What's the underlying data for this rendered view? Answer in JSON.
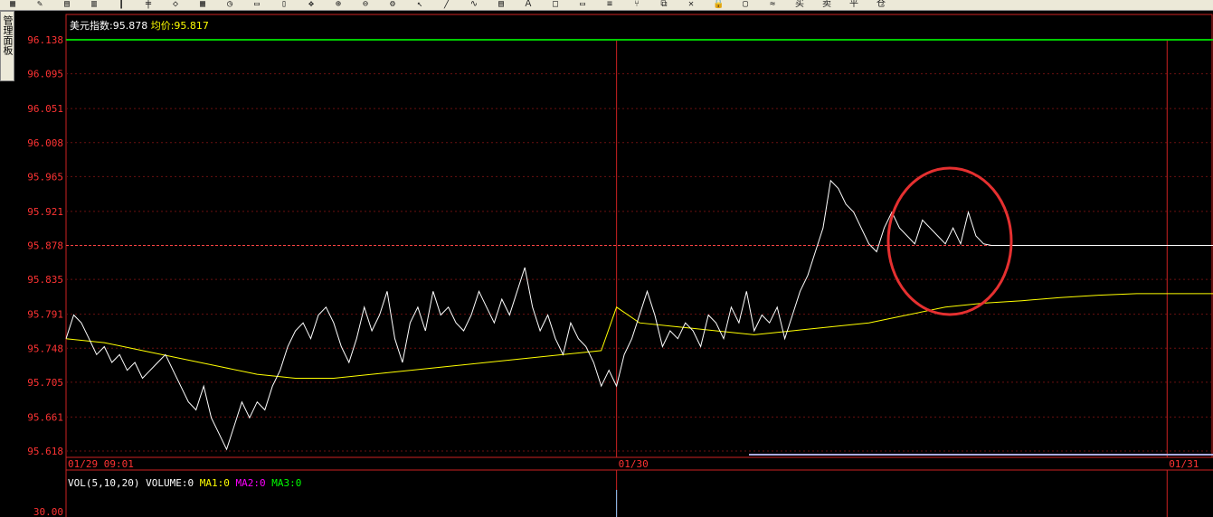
{
  "toolbar": {
    "icons": [
      "grid-icon",
      "pencil-icon",
      "chart-icon",
      "bar-icon",
      "bars-icon",
      "candle-icon",
      "diamond-icon",
      "grid2-icon",
      "clock-icon",
      "doc-icon",
      "doc2-icon",
      "move-icon",
      "zoom-in-icon",
      "zoom-out-icon",
      "gear-icon",
      "arrow-cursor-icon",
      "line-tool-icon",
      "curve-icon",
      "table-icon",
      "text-icon",
      "box-icon",
      "box2-icon",
      "channel-icon",
      "fork-icon",
      "copy-icon",
      "delete-icon",
      "lock-icon",
      "page-icon",
      "mark-icon",
      "buy-icon",
      "sell-icon",
      "flat-icon",
      "down-icon"
    ]
  },
  "side_tab": {
    "label": "管理面板"
  },
  "info": {
    "symbol_label": "美元指数:95.878",
    "avg_label": "均价:95.817"
  },
  "volume_panel": {
    "label": "VOL(5,10,20) VOLUME:0",
    "ma1": "MA1:0",
    "ma2": "MA2:0",
    "ma3": "MA3:0",
    "axis_label": "30.00"
  },
  "colors": {
    "price": "#ffffff",
    "average": "#ffff00",
    "axis_text": "#ff3333",
    "frame": "#cc2222",
    "current_line": "#ff4444",
    "high_line": "#00cc00",
    "circle": "#e53030"
  },
  "chart_data": {
    "type": "line",
    "title": "美元指数",
    "ylim": [
      95.618,
      96.138
    ],
    "y_ticks": [
      "96.138",
      "96.095",
      "96.051",
      "96.008",
      "95.965",
      "95.921",
      "95.878",
      "95.835",
      "95.791",
      "95.748",
      "95.705",
      "95.661",
      "95.618"
    ],
    "x_ticks": [
      "01/29 09:01",
      "01/30",
      "01/31"
    ],
    "x_tick_positions": [
      0,
      1440,
      2880
    ],
    "xlim": [
      0,
      3000
    ],
    "current_value": 95.878,
    "high_value": 96.138,
    "series": [
      {
        "name": "price",
        "x": [
          0,
          20,
          40,
          60,
          80,
          100,
          120,
          140,
          160,
          180,
          200,
          220,
          240,
          260,
          280,
          300,
          320,
          340,
          360,
          380,
          400,
          420,
          440,
          460,
          480,
          500,
          520,
          540,
          560,
          580,
          600,
          620,
          640,
          660,
          680,
          700,
          720,
          740,
          760,
          780,
          800,
          820,
          840,
          860,
          880,
          900,
          920,
          940,
          960,
          980,
          1000,
          1020,
          1040,
          1060,
          1080,
          1100,
          1120,
          1140,
          1160,
          1180,
          1200,
          1220,
          1240,
          1260,
          1280,
          1300,
          1320,
          1340,
          1360,
          1380,
          1400,
          1420,
          1440,
          1460,
          1480,
          1500,
          1520,
          1540,
          1560,
          1580,
          1600,
          1620,
          1640,
          1660,
          1680,
          1700,
          1720,
          1740,
          1760,
          1780,
          1800,
          1820,
          1840,
          1860,
          1880,
          1900,
          1920,
          1940,
          1960,
          1980,
          2000,
          2020,
          2040,
          2060,
          2080,
          2100,
          2120,
          2140,
          2160,
          2180,
          2200,
          2220,
          2240,
          2260,
          2280,
          2300,
          2320,
          2340,
          2360,
          2380,
          2400,
          2420,
          2440,
          2460,
          2480,
          2500,
          2520,
          2540,
          2560,
          2580,
          2600,
          2620,
          2640,
          2660,
          2680,
          2700,
          2720,
          2740,
          2760,
          2780,
          2800,
          2820,
          2840,
          2860,
          2880,
          2900,
          2920,
          2940,
          2960,
          2980,
          3000,
          3020,
          3040,
          3060,
          3080
        ],
        "values": [
          95.76,
          95.79,
          95.78,
          95.76,
          95.74,
          95.75,
          95.73,
          95.74,
          95.72,
          95.73,
          95.71,
          95.72,
          95.73,
          95.74,
          95.72,
          95.7,
          95.68,
          95.67,
          95.7,
          95.66,
          95.64,
          95.62,
          95.65,
          95.68,
          95.66,
          95.68,
          95.67,
          95.7,
          95.72,
          95.75,
          95.77,
          95.78,
          95.76,
          95.79,
          95.8,
          95.78,
          95.75,
          95.73,
          95.76,
          95.8,
          95.77,
          95.79,
          95.82,
          95.76,
          95.73,
          95.78,
          95.8,
          95.77,
          95.82,
          95.79,
          95.8,
          95.78,
          95.77,
          95.79,
          95.82,
          95.8,
          95.78,
          95.81,
          95.79,
          95.82,
          95.85,
          95.8,
          95.77,
          95.79,
          95.76,
          95.74,
          95.78,
          95.76,
          95.75,
          95.73,
          95.7,
          95.72,
          95.7,
          95.74,
          95.76,
          95.79,
          95.82,
          95.79,
          95.75,
          95.77,
          95.76,
          95.78,
          95.77,
          95.75,
          95.79,
          95.78,
          95.76,
          95.8,
          95.78,
          95.82,
          95.77,
          95.79,
          95.78,
          95.8,
          95.76,
          95.79,
          95.82,
          95.84,
          95.87,
          95.9,
          95.96,
          95.95,
          95.93,
          95.92,
          95.9,
          95.88,
          95.87,
          95.9,
          95.92,
          95.9,
          95.89,
          95.88,
          95.91,
          95.9,
          95.89,
          95.88,
          95.9,
          95.88,
          95.92,
          95.89,
          95.88,
          95.878,
          95.878,
          95.878,
          95.878,
          95.878,
          95.878,
          95.878,
          95.878,
          95.878,
          95.878,
          95.878,
          95.878,
          95.878,
          95.878,
          95.878,
          95.878,
          95.878,
          95.878,
          95.878,
          95.878,
          95.878,
          95.878,
          95.878,
          95.878,
          95.878,
          95.878,
          95.878,
          95.878,
          95.878,
          95.878,
          95.878,
          95.878,
          95.878,
          95.878
        ]
      },
      {
        "name": "average",
        "x": [
          0,
          100,
          200,
          300,
          400,
          500,
          600,
          700,
          800,
          900,
          1000,
          1100,
          1200,
          1300,
          1400,
          1440,
          1500,
          1600,
          1700,
          1800,
          1900,
          2000,
          2100,
          2200,
          2300,
          2400,
          2500,
          2600,
          2700,
          2800,
          2900,
          3000
        ],
        "values": [
          95.76,
          95.755,
          95.745,
          95.735,
          95.725,
          95.715,
          95.71,
          95.71,
          95.715,
          95.72,
          95.725,
          95.73,
          95.735,
          95.74,
          95.745,
          95.8,
          95.78,
          95.775,
          95.77,
          95.765,
          95.77,
          95.775,
          95.78,
          95.79,
          95.8,
          95.805,
          95.808,
          95.812,
          95.815,
          95.817,
          95.817,
          95.817
        ]
      }
    ]
  }
}
